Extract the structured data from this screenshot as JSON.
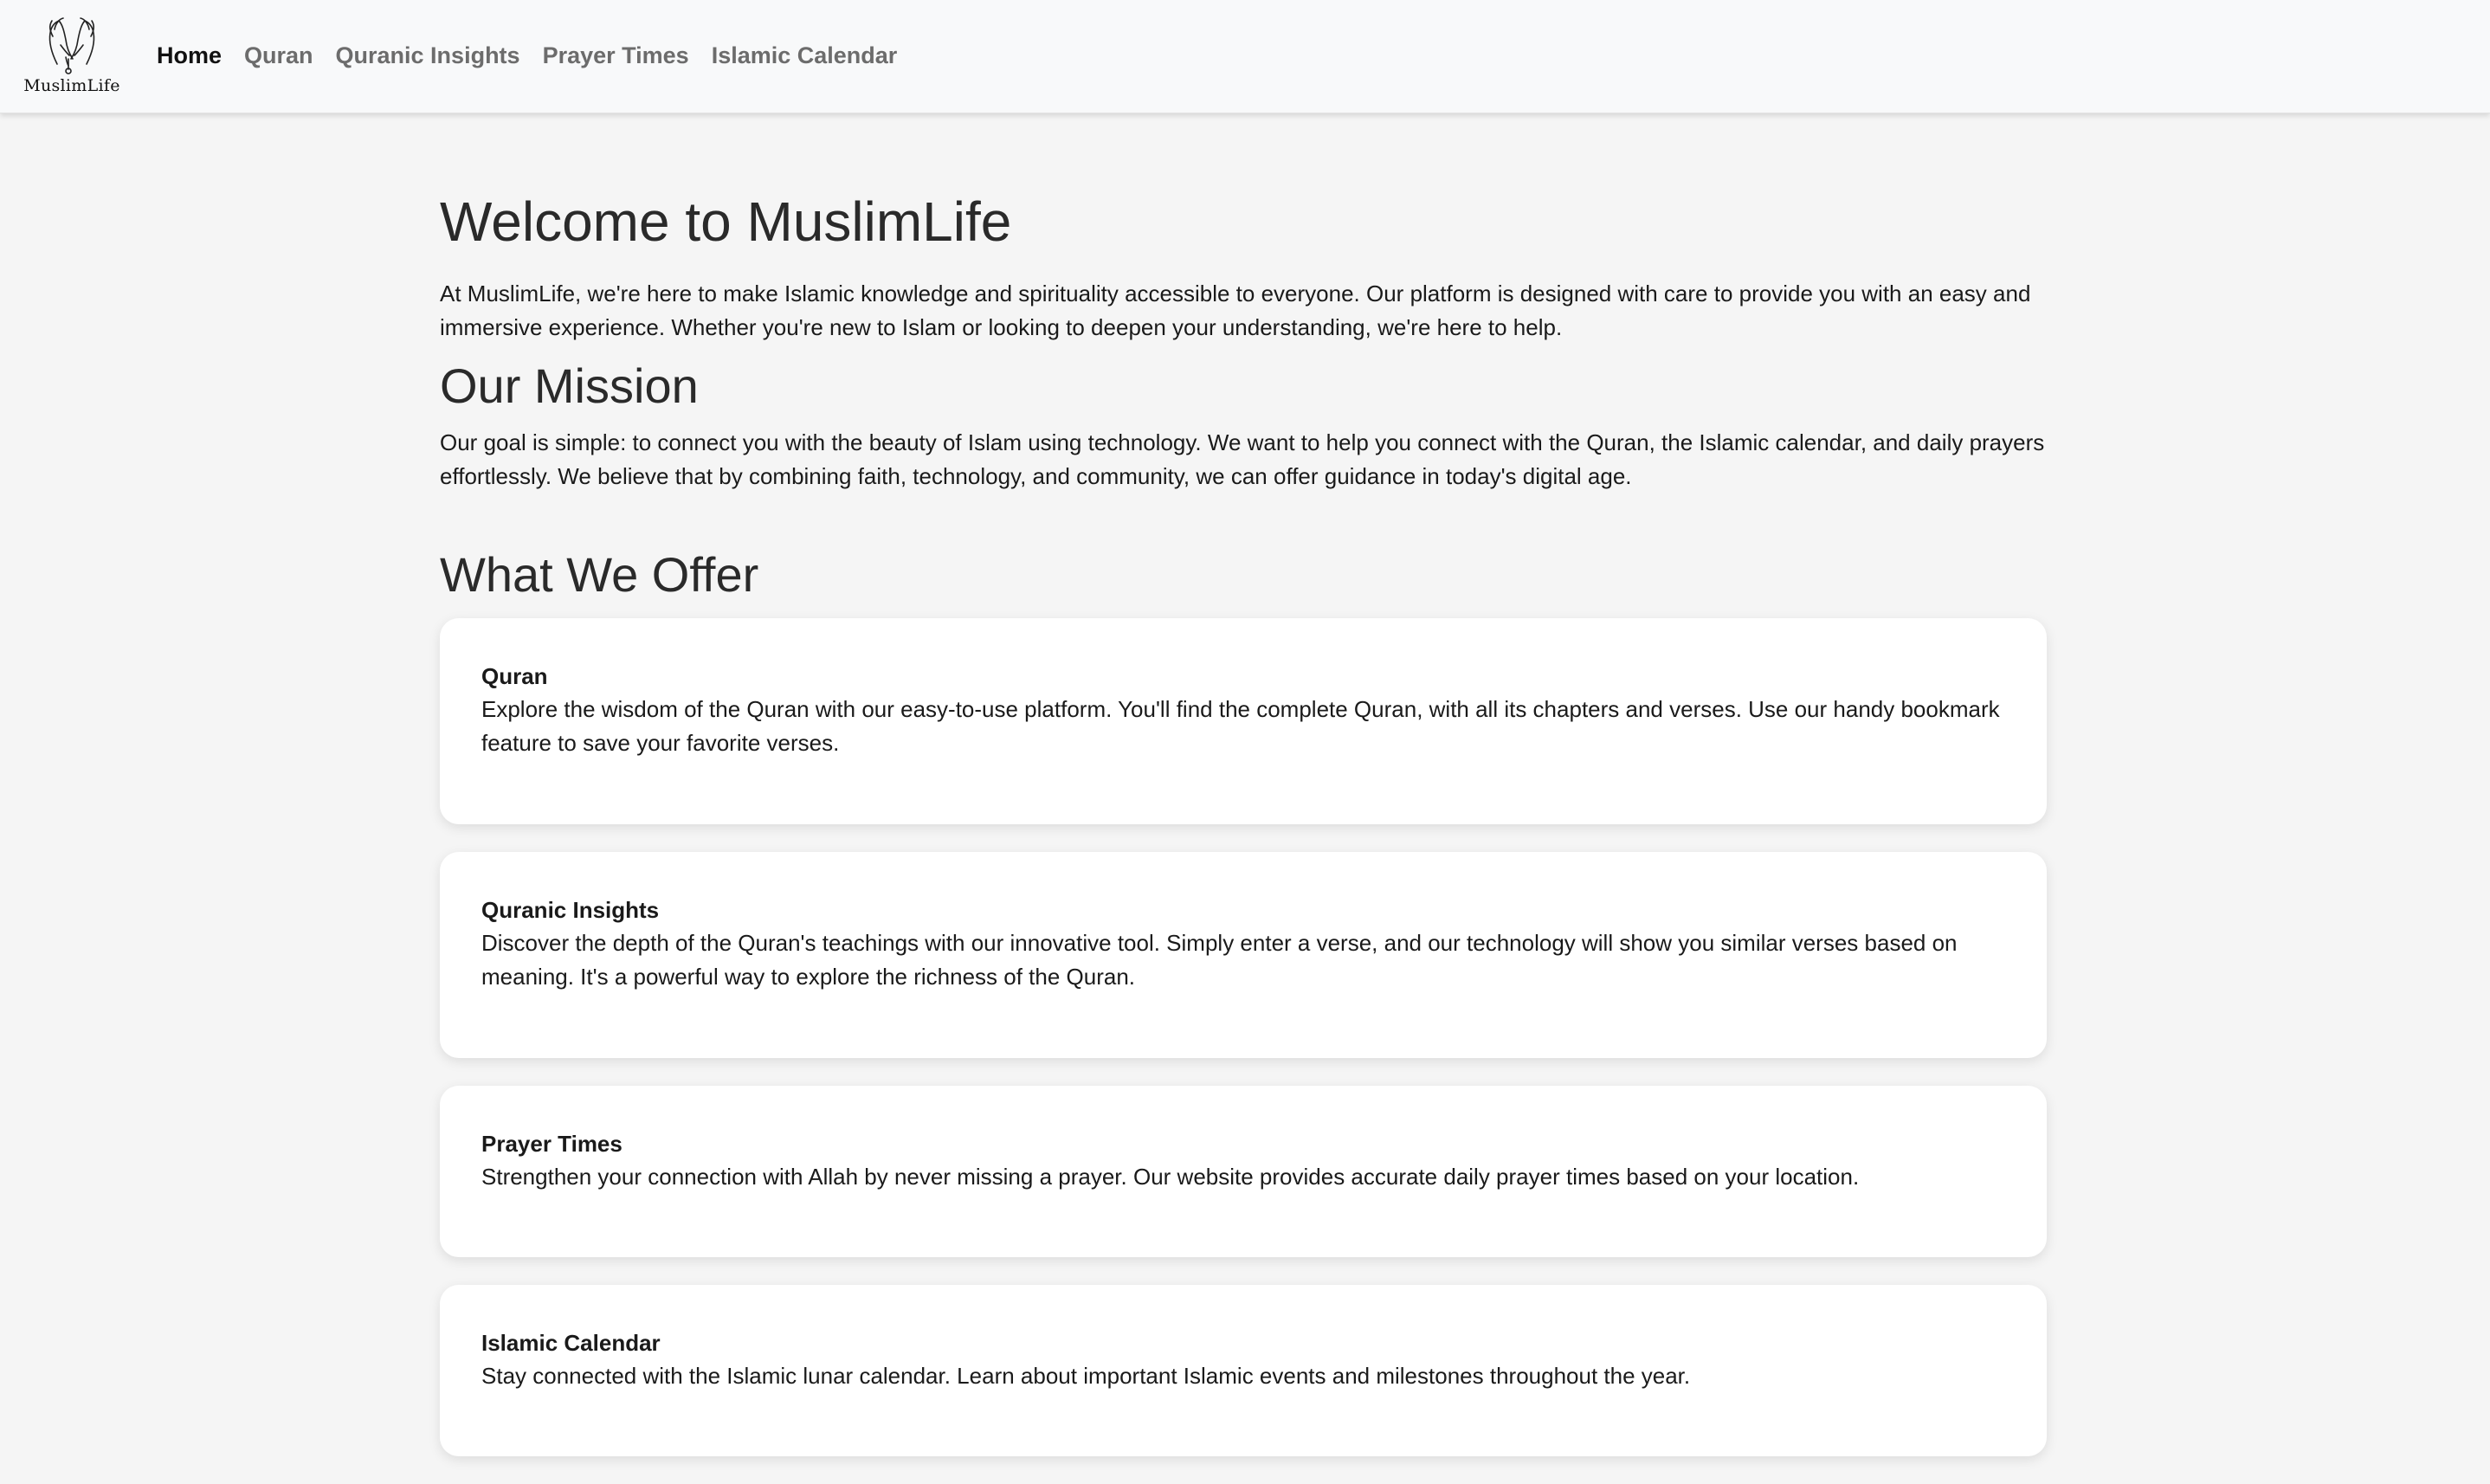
{
  "navbar": {
    "brand": {
      "logo_icon": "praying-hands-icon",
      "name": "MuslimLife"
    },
    "links": [
      {
        "label": "Home",
        "active": true
      },
      {
        "label": "Quran",
        "active": false
      },
      {
        "label": "Quranic Insights",
        "active": false
      },
      {
        "label": "Prayer Times",
        "active": false
      },
      {
        "label": "Islamic Calendar",
        "active": false
      }
    ]
  },
  "welcome": {
    "title": "Welcome to MuslimLife",
    "text": "At MuslimLife, we're here to make Islamic knowledge and spirituality accessible to everyone. Our platform is designed with care to provide you with an easy and immersive experience. Whether you're new to Islam or looking to deepen your understanding, we're here to help."
  },
  "mission": {
    "title": "Our Mission",
    "text": "Our goal is simple: to connect you with the beauty of Islam using technology. We want to help you connect with the Quran, the Islamic calendar, and daily prayers effortlessly. We believe that by combining faith, technology, and community, we can offer guidance in today's digital age."
  },
  "offer": {
    "title": "What We Offer",
    "cards": [
      {
        "title": "Quran",
        "text": "Explore the wisdom of the Quran with our easy-to-use platform. You'll find the complete Quran, with all its chapters and verses. Use our handy bookmark feature to save your favorite verses."
      },
      {
        "title": "Quranic Insights",
        "text": "Discover the depth of the Quran's teachings with our innovative tool. Simply enter a verse, and our technology will show you similar verses based on meaning. It's a powerful way to explore the richness of the Quran."
      },
      {
        "title": "Prayer Times",
        "text": "Strengthen your connection with Allah by never missing a prayer. Our website provides accurate daily prayer times based on your location."
      },
      {
        "title": "Islamic Calendar",
        "text": "Stay connected with the Islamic lunar calendar. Learn about important Islamic events and milestones throughout the year."
      }
    ]
  },
  "colors": {
    "page_background": "#f5f5f5",
    "navbar_background": "#f8f9fa",
    "card_background": "#ffffff",
    "nav_active": "#111111",
    "nav_inactive": "#6c6c6c"
  }
}
